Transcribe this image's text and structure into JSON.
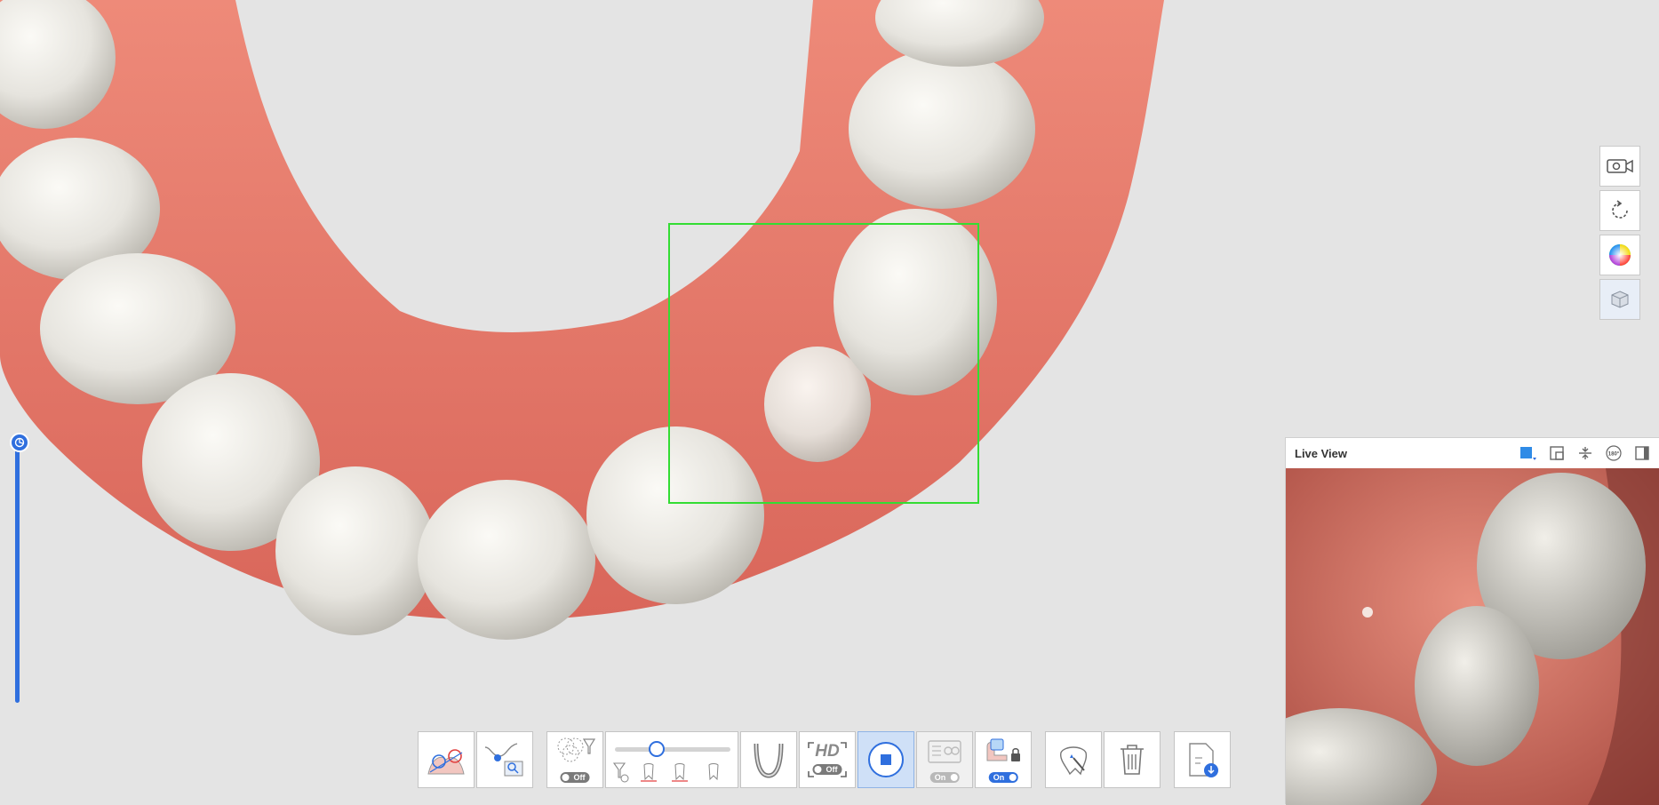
{
  "scan_view": {
    "tooth_color": "#ecebe6",
    "gum_color": "#e87c6c",
    "frame_color": "#33dd33"
  },
  "live_view": {
    "title": "Live View",
    "rotate_label": "180°"
  },
  "toolbar": {
    "filter_toggle": "Off",
    "hd_label": "HD",
    "hd_toggle": "Off",
    "ai_toggle": "On",
    "lock_toggle": "On"
  },
  "colors": {
    "accent": "#2f6fde",
    "background": "#e4e4e4"
  }
}
